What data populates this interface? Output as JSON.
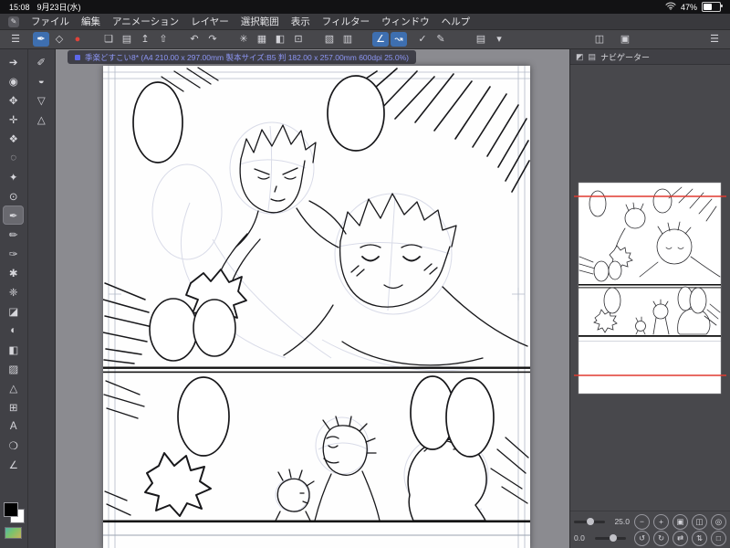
{
  "status_bar": {
    "time": "15:08",
    "date": "9月23日(水)",
    "battery_percent": "47%",
    "icons": [
      "wifi-icon",
      "battery-icon"
    ]
  },
  "menu_bar": {
    "items": [
      {
        "name": "menu-file",
        "label": "ファイル"
      },
      {
        "name": "menu-edit",
        "label": "編集"
      },
      {
        "name": "menu-animation",
        "label": "アニメーション"
      },
      {
        "name": "menu-layer",
        "label": "レイヤー"
      },
      {
        "name": "menu-selection",
        "label": "選択範囲"
      },
      {
        "name": "menu-view",
        "label": "表示"
      },
      {
        "name": "menu-filter",
        "label": "フィルター"
      },
      {
        "name": "menu-window",
        "label": "ウィンドウ"
      },
      {
        "name": "menu-help",
        "label": "ヘルプ"
      }
    ]
  },
  "toolbar": {
    "icons": [
      {
        "name": "main-menu-icon",
        "glyph": "☰"
      },
      {
        "name": "pen-quick-icon",
        "glyph": "✒",
        "selected": true,
        "gap": 8
      },
      {
        "name": "eraser-quick-icon",
        "glyph": "◇"
      },
      {
        "name": "timelapse-record-icon",
        "glyph": "●",
        "color": "#e0433a"
      },
      {
        "name": "new-canvas-icon",
        "glyph": "❏",
        "gap": 14
      },
      {
        "name": "open-file-icon",
        "glyph": "▤"
      },
      {
        "name": "save-icon",
        "glyph": "↥"
      },
      {
        "name": "export-icon",
        "glyph": "⇧"
      },
      {
        "name": "undo-icon",
        "glyph": "↶",
        "gap": 14
      },
      {
        "name": "redo-icon",
        "glyph": "↷"
      },
      {
        "name": "clear-icon",
        "glyph": "✳",
        "gap": 14
      },
      {
        "name": "grid-icon",
        "glyph": "▦"
      },
      {
        "name": "fill-quick-icon",
        "glyph": "◧"
      },
      {
        "name": "crop-icon",
        "glyph": "⊡"
      },
      {
        "name": "material-icon",
        "glyph": "▧",
        "gap": 14
      },
      {
        "name": "pattern-icon",
        "glyph": "▥"
      },
      {
        "name": "snap-line-icon",
        "glyph": "∠",
        "selected": true,
        "gap": 16
      },
      {
        "name": "snap-curve-icon",
        "glyph": "↝",
        "selected": true
      },
      {
        "name": "check-icon",
        "glyph": "✓",
        "gap": 6
      },
      {
        "name": "edit-line-icon",
        "glyph": "✎"
      },
      {
        "name": "layer-quick-icon",
        "glyph": "▤",
        "gap": 24
      },
      {
        "name": "dropdown-icon",
        "glyph": "▾"
      }
    ],
    "right_icons": [
      {
        "name": "workspace-icon",
        "glyph": "◫"
      },
      {
        "name": "palette-dock-icon",
        "glyph": "▣"
      },
      {
        "name": "overflow-menu-icon",
        "glyph": "☰",
        "gap": 70
      }
    ]
  },
  "document_tab": {
    "title": "季楽どすこい8* (A4 210.00 x 297.00mm 製本サイズ:B5 判 182.00 x 257.00mm 600dpi 25.0%)"
  },
  "tool_palette": {
    "primary": [
      {
        "name": "tool-operation",
        "glyph": "➔"
      },
      {
        "name": "tool-zoom",
        "glyph": "◉"
      },
      {
        "name": "tool-hand",
        "glyph": "✥"
      },
      {
        "name": "tool-move",
        "glyph": "✛"
      },
      {
        "name": "tool-object",
        "glyph": "❖"
      },
      {
        "name": "tool-lasso-select",
        "glyph": "◌"
      },
      {
        "name": "tool-auto-select",
        "glyph": "✦"
      },
      {
        "name": "tool-eyedropper",
        "glyph": "⊙"
      },
      {
        "name": "tool-pen",
        "glyph": "✒",
        "selected": true
      },
      {
        "name": "tool-pencil",
        "glyph": "✏"
      },
      {
        "name": "tool-brush",
        "glyph": "✑"
      },
      {
        "name": "tool-airbrush",
        "glyph": "✱"
      },
      {
        "name": "tool-decoration",
        "glyph": "❈"
      },
      {
        "name": "tool-eraser",
        "glyph": "◪"
      },
      {
        "name": "tool-blend",
        "glyph": "◐"
      },
      {
        "name": "tool-fill",
        "glyph": "◧"
      },
      {
        "name": "tool-gradient",
        "glyph": "▨"
      },
      {
        "name": "tool-figure",
        "glyph": "△"
      },
      {
        "name": "tool-frame-border",
        "glyph": "⊞"
      },
      {
        "name": "tool-text",
        "glyph": "A"
      },
      {
        "name": "tool-balloon",
        "glyph": "❍"
      },
      {
        "name": "tool-correct-line",
        "glyph": "∠"
      }
    ],
    "secondary": [
      {
        "name": "subtool-pen-icon",
        "glyph": "✐"
      },
      {
        "name": "subtool-eraser-icon",
        "glyph": "◒"
      },
      {
        "name": "subtool-select-icon",
        "glyph": "▽"
      },
      {
        "name": "subtool-ruler-icon",
        "glyph": "△"
      }
    ],
    "colors": {
      "main": "#000000",
      "sub": "#ffffff"
    }
  },
  "navigator": {
    "title": "ナビゲーター",
    "header_icons": [
      {
        "name": "panel-tab-icon",
        "glyph": "◩"
      },
      {
        "name": "panel-list-icon",
        "glyph": "▤"
      }
    ],
    "zoom_value": "25.0",
    "rotation_value": "0.0",
    "view_guide_color": "#e03a30",
    "zoom_buttons": [
      {
        "name": "zoom-out-button",
        "glyph": "−"
      },
      {
        "name": "zoom-in-button",
        "glyph": "+"
      },
      {
        "name": "fit-screen-button",
        "glyph": "▣"
      },
      {
        "name": "fit-width-button",
        "glyph": "◫"
      },
      {
        "name": "actual-size-button",
        "glyph": "◎"
      }
    ],
    "rotation_buttons": [
      {
        "name": "rotate-left-button",
        "glyph": "↺"
      },
      {
        "name": "rotate-right-button",
        "glyph": "↻"
      },
      {
        "name": "flip-horizontal-button",
        "glyph": "⇄"
      },
      {
        "name": "flip-vertical-button",
        "glyph": "⇅"
      },
      {
        "name": "reset-view-button",
        "glyph": "□"
      }
    ]
  },
  "canvas": {
    "content_note": "Rough manga page line art: 2 panels, empty speech balloons, two characters top panel, three figures bottom panel, speed lines"
  }
}
